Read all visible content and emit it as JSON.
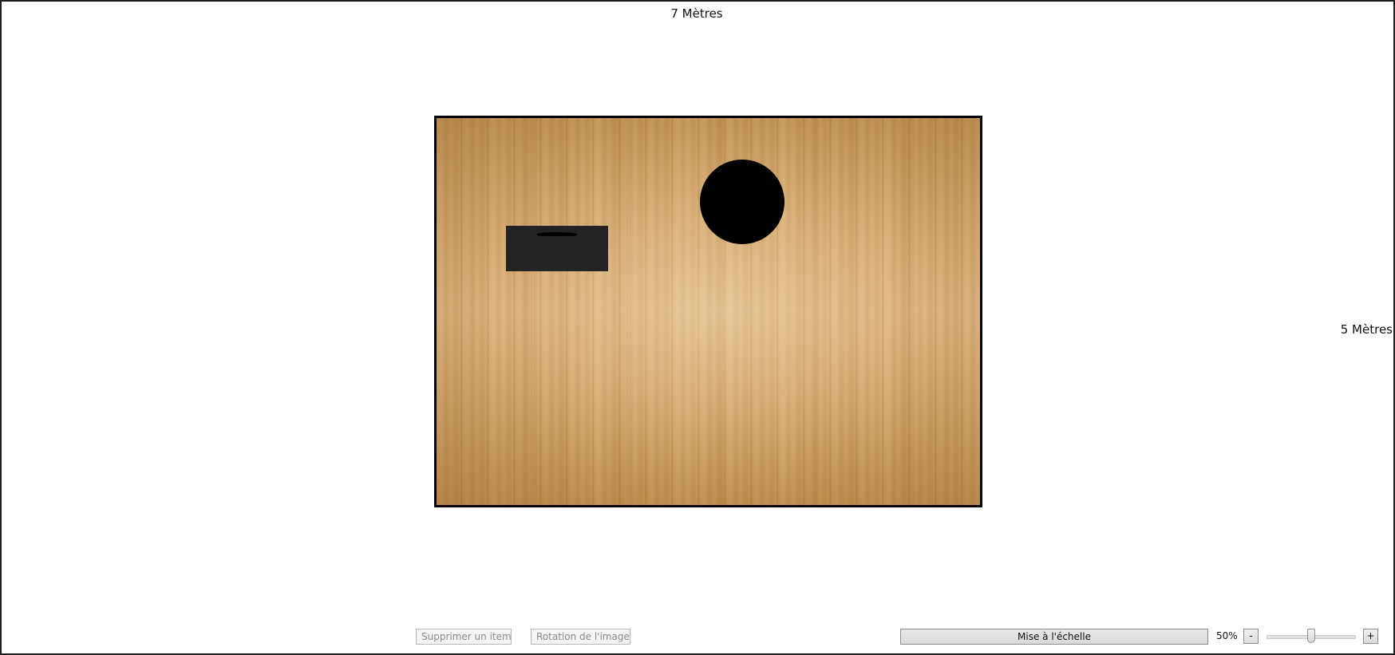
{
  "dimensions": {
    "width_label": "7 Mètres",
    "height_label": "5 Mètres"
  },
  "room": {
    "floor": "wood-parquet",
    "items": [
      {
        "name": "desk",
        "shape": "rectangle",
        "color": "#232323"
      },
      {
        "name": "round-table",
        "shape": "circle",
        "color": "#000000"
      }
    ]
  },
  "toolbar": {
    "delete_label": "Supprimer un item",
    "rotate_label": "Rotation de l'image",
    "scale_label": "Mise à l'échelle",
    "zoom_value": "50%",
    "zoom_fraction": 0.5,
    "zoom_minus_label": "-",
    "zoom_plus_label": "+"
  }
}
